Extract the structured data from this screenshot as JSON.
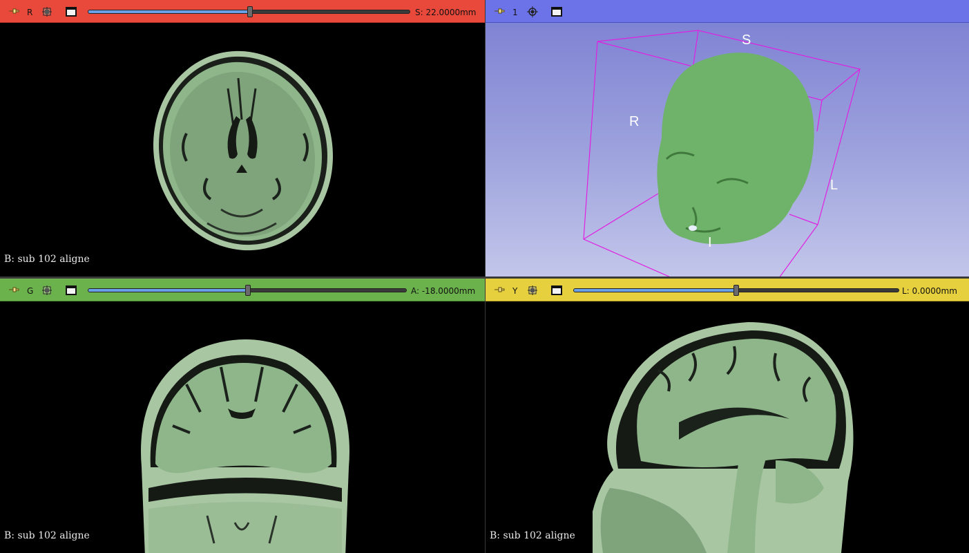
{
  "views": {
    "red": {
      "label": "R",
      "offset": "S: 22.0000mm",
      "slider_fraction": 0.503,
      "caption": "B: sub 102 aligne",
      "color": "#e9493a"
    },
    "three_d": {
      "label": "1",
      "orientation": {
        "superior": "S",
        "right": "R",
        "left": "L",
        "inferior": "I"
      },
      "color": "#6c72e8",
      "box_color": "#e020e0"
    },
    "green": {
      "label": "G",
      "offset": "A: -18.0000mm",
      "slider_fraction": 0.503,
      "caption": "B: sub 102 aligne",
      "color": "#6bb24c"
    },
    "yellow": {
      "label": "Y",
      "offset": "L: 0.0000mm",
      "slider_fraction": 0.5,
      "caption": "B: sub 102 aligne",
      "color": "#e6d03d"
    }
  },
  "icons": {
    "pin": "pin-icon",
    "link": "link-icon",
    "center": "center-3d-icon",
    "maximize": "view-layout-icon"
  },
  "colors": {
    "tissue": "#8fb68a",
    "tissue_dark": "#6f946b",
    "skin": "#a9c6a3",
    "volume_render": "#6fb36a"
  }
}
